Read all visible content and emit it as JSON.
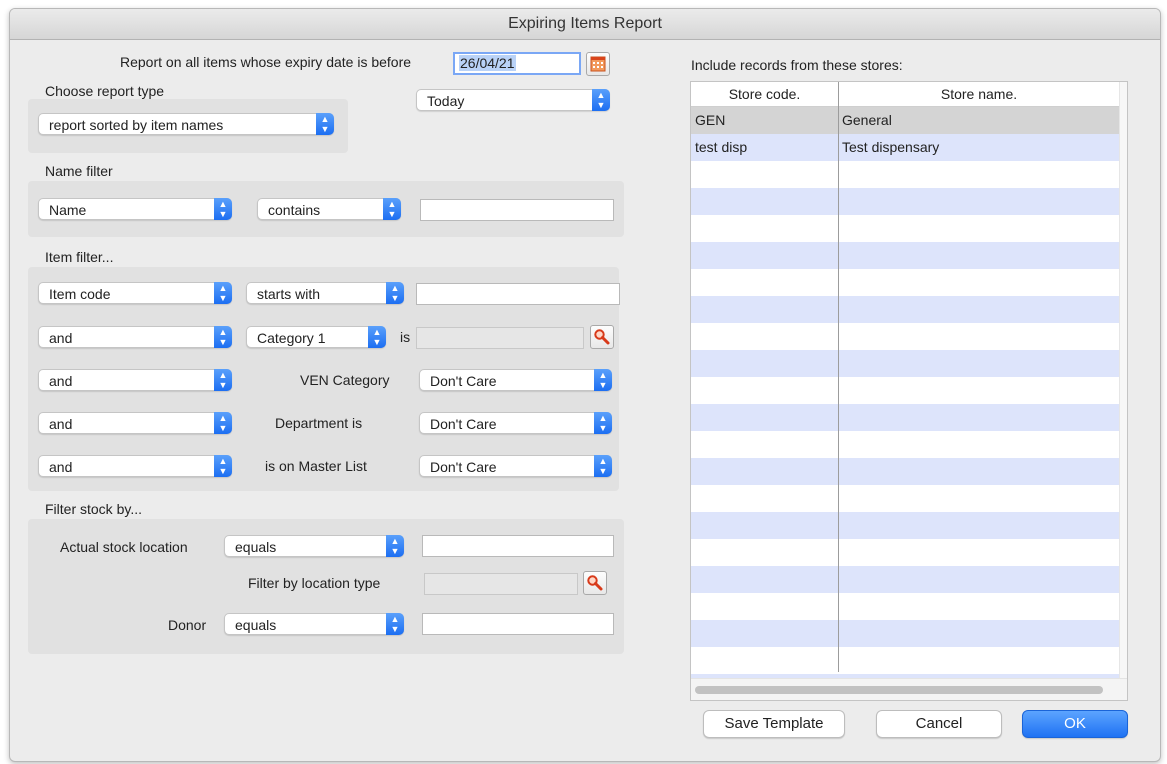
{
  "window": {
    "title": "Expiring Items Report"
  },
  "expiry": {
    "label": "Report on all items whose expiry date is before",
    "date": "26/04/21",
    "preset": "Today"
  },
  "report_type": {
    "heading": "Choose report type",
    "value": "report sorted by item names"
  },
  "name_filter": {
    "heading": "Name filter",
    "field": "Name",
    "operator": "contains",
    "value": ""
  },
  "item_filter": {
    "heading": "Item filter...",
    "row1": {
      "field": "Item code",
      "operator": "starts with",
      "value": ""
    },
    "row2": {
      "conj": "and",
      "field": "Category 1",
      "is_label": "is",
      "value": ""
    },
    "row3": {
      "conj": "and",
      "label": "VEN Category",
      "value": "Don't Care"
    },
    "row4": {
      "conj": "and",
      "label": "Department is",
      "value": "Don't Care"
    },
    "row5": {
      "conj": "and",
      "label": "is on Master List",
      "value": "Don't Care"
    }
  },
  "stock_filter": {
    "heading": "Filter stock by...",
    "location": {
      "label": "Actual stock location",
      "operator": "equals",
      "value": ""
    },
    "location_type": {
      "label": "Filter by location type",
      "value": ""
    },
    "donor": {
      "label": "Donor",
      "operator": "equals",
      "value": ""
    }
  },
  "stores": {
    "heading": "Include records from these stores:",
    "columns": [
      "Store code.",
      "Store name."
    ],
    "rows": [
      {
        "code": "GEN",
        "name": "General"
      },
      {
        "code": "test disp",
        "name": "Test dispensary"
      }
    ]
  },
  "buttons": {
    "save_template": "Save Template",
    "cancel": "Cancel",
    "ok": "OK"
  },
  "colors": {
    "accent": "#1f72f3",
    "row_stripe": "#dde4fb",
    "row_selected": "#d4d4d4"
  },
  "icons": {
    "calendar": "calendar-icon",
    "lookup": "magnifier-icon"
  }
}
